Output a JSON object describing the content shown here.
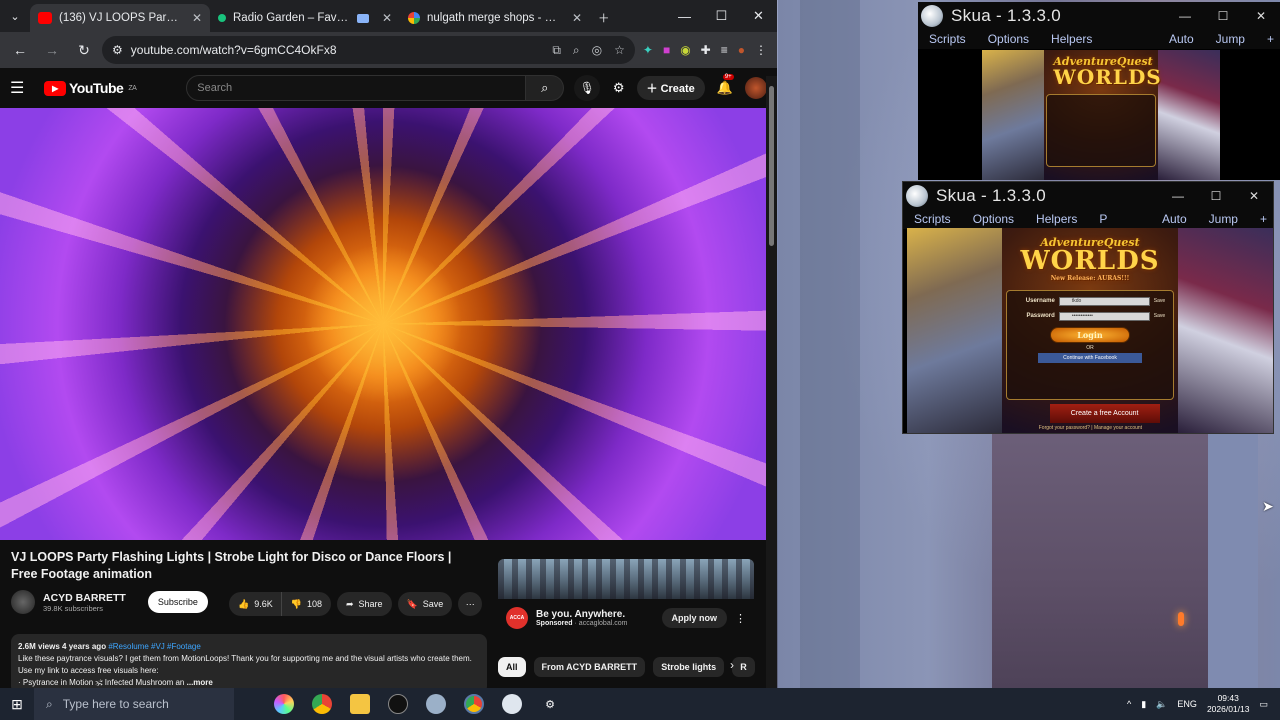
{
  "browser": {
    "tabs": [
      {
        "label": "(136) VJ LOOPS Party Flashing L",
        "icon": "youtube-favicon",
        "color": "#ff0000"
      },
      {
        "label": "Radio Garden – Favorites",
        "icon": "radio-garden-favicon",
        "color": "#19c37d"
      },
      {
        "label": "nulgath merge shops - Google",
        "icon": "google-favicon",
        "color": "#ffffff"
      }
    ],
    "url": "youtube.com/watch?v=6gmCC4OkFx8"
  },
  "youtube": {
    "logo_text": "YouTube",
    "logo_region": "ZA",
    "search_placeholder": "Search",
    "create_label": "Create",
    "notifications_badge": "9+",
    "video_title": "VJ LOOPS Party Flashing Lights | Strobe Light for Disco or Dance Floors | Free Footage animation",
    "channel_name": "ACYD BARRETT",
    "channel_subs": "39.8K subscribers",
    "subscribe_label": "Subscribe",
    "likes": "9.6K",
    "dislikes": "108",
    "share_label": "Share",
    "save_label": "Save",
    "description": {
      "views": "2.6M views",
      "age": "4 years ago",
      "tags": "#Resolume #VJ #Footage",
      "line1": "Like these paytrance visuals? I get them from MotionLoops! Thank you for supporting me and the visual artists who create them. Use my link to access free visuals here:",
      "line2": "· Psytrance in Motion 🕉 Infected Mushroom an",
      "more": "...more"
    },
    "ad": {
      "title": "Be you. Anywhere.",
      "sponsored": "Sponsored",
      "domain": "accaglobal.com",
      "brand": "ACCA",
      "cta": "Apply now"
    },
    "chips": [
      "All",
      "From ACYD BARRETT",
      "Strobe lights",
      "R"
    ]
  },
  "skua": [
    {
      "title": "Skua - 1.3.3.0",
      "menu": [
        "Scripts",
        "Options",
        "Helpers"
      ],
      "menu_right": [
        "Auto",
        "Jump",
        "+"
      ]
    },
    {
      "title": "Skua - 1.3.3.0",
      "menu": [
        "Scripts",
        "Options",
        "Helpers",
        "P"
      ],
      "menu_right": [
        "Auto",
        "Jump",
        "+"
      ],
      "game": {
        "logo_top": "AdventureQuest",
        "logo_main": "WORLDS",
        "release": "New Release: AURAS!!!",
        "username_label": "Username",
        "username_value": "tkdo",
        "password_label": "Password",
        "password_value": "••••••••••••",
        "save_label": "Save",
        "login_label": "Login",
        "or_label": "OR",
        "facebook_label": "Continue with Facebook",
        "create_account": "Create a free Account",
        "recover": "Forgot your password?  |  Manage your account"
      }
    }
  ],
  "taskbar": {
    "search_placeholder": "Type here to search",
    "language": "ENG",
    "time": "09:43",
    "date": "2026/01/13"
  }
}
